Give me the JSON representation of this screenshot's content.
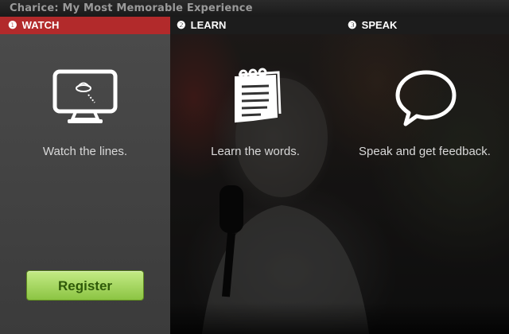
{
  "window": {
    "title": "Charice: My Most Memorable Experience"
  },
  "tabs": [
    {
      "number": "❶",
      "label": "WATCH"
    },
    {
      "number": "❷",
      "label": "LEARN"
    },
    {
      "number": "❸",
      "label": "SPEAK"
    }
  ],
  "steps": [
    {
      "icon": "monitor-icon",
      "text": "Watch the lines."
    },
    {
      "icon": "notepad-icon",
      "text": "Learn the words."
    },
    {
      "icon": "speech-bubble-icon",
      "text": "Speak and get feedback."
    }
  ],
  "register": {
    "label": "Register"
  },
  "colors": {
    "active_tab": "#b22a2b",
    "register_button": "#9fd052"
  }
}
